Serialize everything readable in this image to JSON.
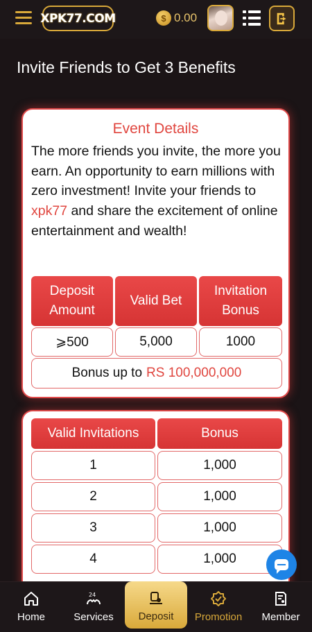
{
  "header": {
    "logo_text": "XPK77.COM",
    "balance": "0.00",
    "coin_symbol": "$"
  },
  "page_title": "Invite Friends to Get 3 Benefits",
  "event": {
    "heading": "Event Details",
    "desc_before": "The more friends you invite, the more you earn. An opportunity to earn millions with zero investment! Invite your friends to ",
    "desc_highlight": "xpk77",
    "desc_after": " and share the excitement of online entertainment and wealth!",
    "headers": [
      "Deposit Amount",
      "Valid Bet",
      "Invitation Bonus"
    ],
    "values": [
      "⩾500",
      "5,000",
      "1000"
    ],
    "bonus_label": "Bonus up to",
    "bonus_amount": "RS 100,000,000"
  },
  "invites": {
    "headers": [
      "Valid Invitations",
      "Bonus"
    ],
    "rows": [
      {
        "count": "1",
        "bonus": "1,000"
      },
      {
        "count": "2",
        "bonus": "1,000"
      },
      {
        "count": "3",
        "bonus": "1,000"
      },
      {
        "count": "4",
        "bonus": "1,000"
      }
    ]
  },
  "nav": {
    "home": "Home",
    "services": "Services",
    "deposit": "Deposit",
    "promotion": "Promotion",
    "member": "Member"
  },
  "colors": {
    "accent_gold": "#d9a93a",
    "accent_red": "#e0463f",
    "chat_blue": "#1e84e6"
  }
}
